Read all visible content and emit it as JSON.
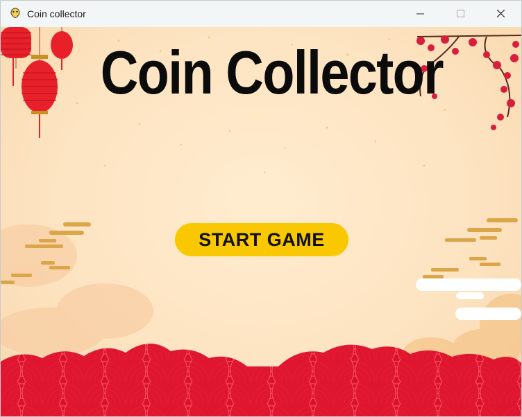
{
  "window": {
    "title": "Coin collector",
    "icon": "python-icon",
    "controls": [
      "minimize-icon",
      "maximize-icon",
      "close-icon"
    ]
  },
  "game": {
    "title": "Coin Collector",
    "start_button_label": "START GAME"
  },
  "colors": {
    "background": "#fde4c2",
    "button": "#f9c800",
    "lantern": "#e8202a",
    "waves": "#e0162f"
  }
}
